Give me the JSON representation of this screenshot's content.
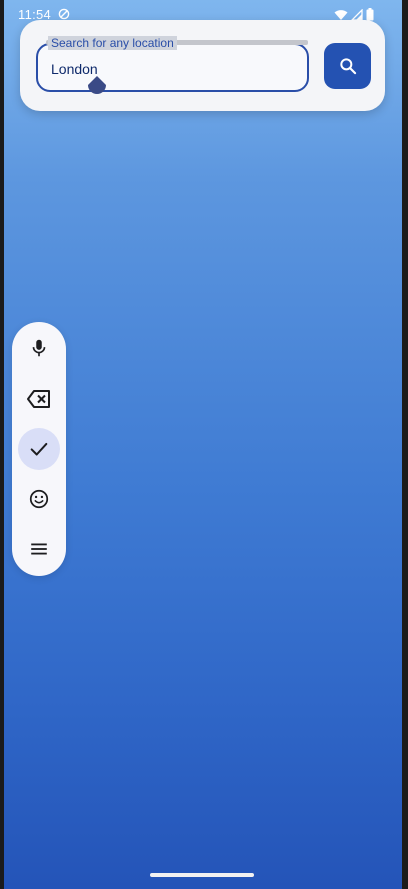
{
  "status_bar": {
    "time": "11:54",
    "icons": [
      "do-not-disturb-icon",
      "wifi-icon",
      "signal-icon",
      "battery-icon"
    ]
  },
  "search": {
    "label": "Search for any location",
    "value": "London",
    "button_icon": "search-icon"
  },
  "toolbar": {
    "items": [
      {
        "icon": "microphone-icon",
        "selected": false
      },
      {
        "icon": "backspace-icon",
        "selected": false
      },
      {
        "icon": "check-icon",
        "selected": true
      },
      {
        "icon": "emoji-icon",
        "selected": false
      },
      {
        "icon": "menu-icon",
        "selected": false
      }
    ]
  },
  "colors": {
    "accent": "#2452b2",
    "gradient_top": "#7fb6ee",
    "gradient_bottom": "#2454b8"
  }
}
